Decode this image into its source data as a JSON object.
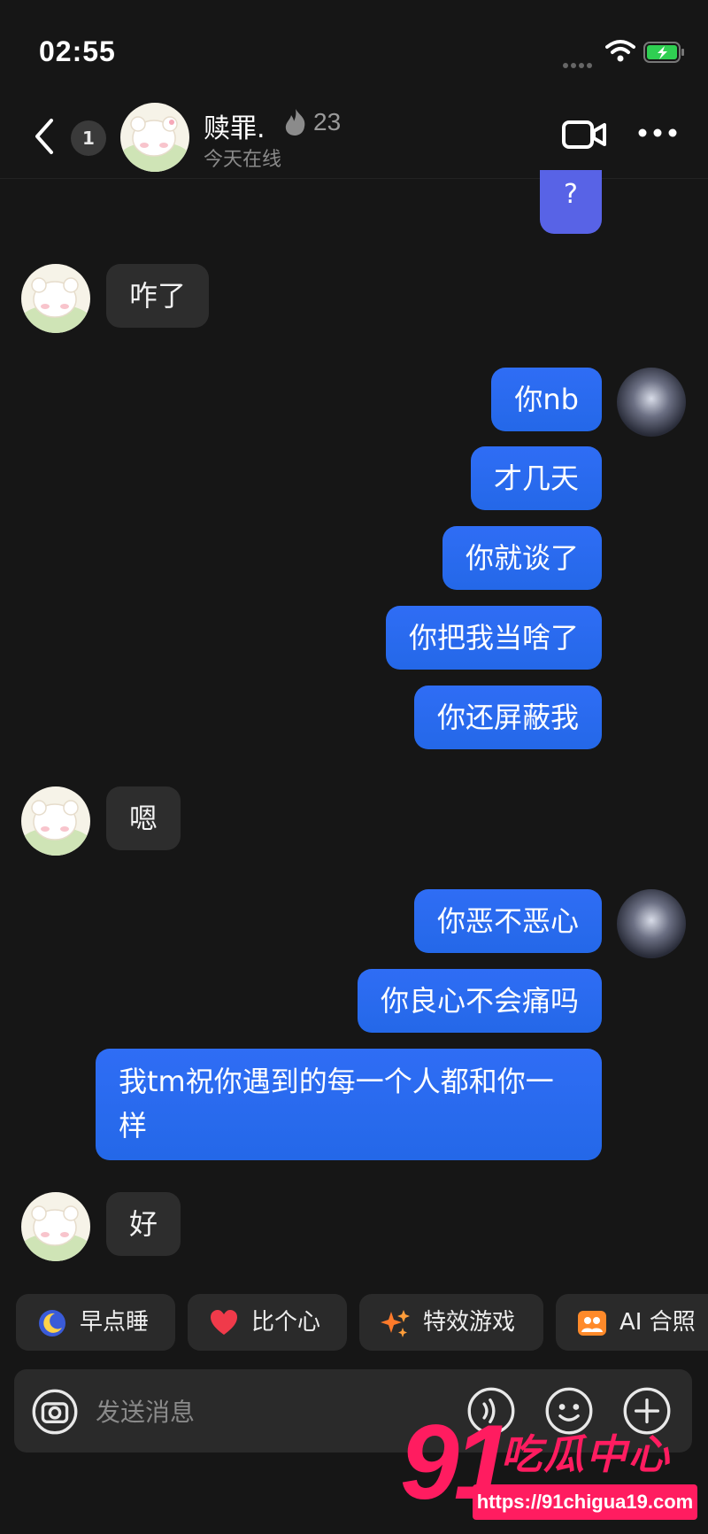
{
  "status_bar": {
    "time": "02:55"
  },
  "header": {
    "unread_count": "1",
    "contact_name": "赎罪.",
    "streak_count": "23",
    "online_status": "今天在线"
  },
  "messages": [
    {
      "side": "out",
      "text": "?"
    },
    {
      "side": "in",
      "text": "咋了"
    },
    {
      "side": "out",
      "text": "你nb"
    },
    {
      "side": "out",
      "text": "才几天"
    },
    {
      "side": "out",
      "text": "你就谈了"
    },
    {
      "side": "out",
      "text": "你把我当啥了"
    },
    {
      "side": "out",
      "text": "你还屏蔽我"
    },
    {
      "side": "in",
      "text": "嗯"
    },
    {
      "side": "out",
      "text": "你恶不恶心"
    },
    {
      "side": "out",
      "text": "你良心不会痛吗"
    },
    {
      "side": "out",
      "text": "我tm祝你遇到的每一个人都和你一样"
    },
    {
      "side": "in",
      "text": "好"
    }
  ],
  "quick_replies": [
    {
      "label": "早点睡",
      "icon": "moon-icon"
    },
    {
      "label": "比个心",
      "icon": "heart-icon"
    },
    {
      "label": "特效游戏",
      "icon": "sparkle-icon"
    },
    {
      "label": "AI 合照",
      "icon": "photo-icon"
    }
  ],
  "input": {
    "placeholder": "发送消息"
  },
  "watermark": {
    "number": "91",
    "text": "吃瓜中心",
    "url": "https://91chigua19.com"
  },
  "colors": {
    "background": "#161616",
    "outgoing_bubble": "#2d6cf2",
    "incoming_bubble": "#2d2d2d",
    "watermark": "#ff1c60"
  }
}
